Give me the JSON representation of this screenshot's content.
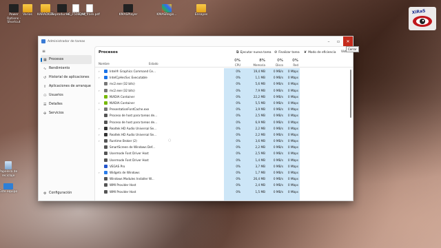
{
  "desktop_icons": [
    {
      "label": "Power\nOptions -\nShortcut",
      "kind": "app-dark"
    },
    {
      "label": "Varios",
      "kind": "folder"
    },
    {
      "label": "KARAOKES",
      "kind": "folder"
    },
    {
      "label": "Reproductor...",
      "kind": "app-dark"
    },
    {
      "label": "HC_F508.pdf",
      "kind": "doc"
    },
    {
      "label": "DNI_frare.pdf",
      "kind": "doc"
    },
    {
      "label": "KMASPlayer",
      "kind": "app-dark"
    },
    {
      "label": "KMASRegis...",
      "kind": "app-game"
    },
    {
      "label": "Ensayos",
      "kind": "folder"
    },
    {
      "label": "Papelera de reciclaje",
      "kind": "bin"
    },
    {
      "label": "Este equipo",
      "kind": "pc"
    }
  ],
  "window": {
    "title": "Administrador de tareas",
    "close_tooltip": "Cerrar"
  },
  "sidebar": {
    "items": [
      {
        "label": "Procesos",
        "icon": "grid-icon"
      },
      {
        "label": "Rendimiento",
        "icon": "chart-icon"
      },
      {
        "label": "Historial de aplicaciones",
        "icon": "history-icon"
      },
      {
        "label": "Aplicaciones de arranque",
        "icon": "rocket-icon"
      },
      {
        "label": "Usuarios",
        "icon": "users-icon"
      },
      {
        "label": "Detalles",
        "icon": "list-icon"
      },
      {
        "label": "Servicios",
        "icon": "puzzle-icon"
      }
    ],
    "settings": "Configuración"
  },
  "main": {
    "title": "Procesos",
    "toolbar": {
      "run": "Ejecutar nueva tarea",
      "end": "Finalizar tarea",
      "efficiency": "Modo de eficiencia",
      "view": "Vista"
    },
    "columns": {
      "name": "Nombre",
      "status": "Estado",
      "cpu_pct": "0%",
      "cpu": "CPU",
      "mem_pct": "8%",
      "mem": "Memoria",
      "disk_pct": "0%",
      "disk": "Disco",
      "net_pct": "0%",
      "net": "Red"
    },
    "rows": [
      {
        "name": "Intel® Graphics Command Ce...",
        "exp": true,
        "color": "#1a73e8",
        "cpu": "0%",
        "mem": "19,4 MB",
        "disk": "0 MB/s",
        "net": "0 Mbps"
      },
      {
        "name": "IntelCpHecSvc Executable",
        "exp": true,
        "color": "#1a73e8",
        "cpu": "0%",
        "mem": "1,1 MB",
        "disk": "0 MB/s",
        "net": "0 Mbps"
      },
      {
        "name": "mc2.exe (32 bits)",
        "exp": false,
        "color": "#777777",
        "cpu": "0%",
        "mem": "5,6 MB",
        "disk": "0 MB/s",
        "net": "0 Mbps"
      },
      {
        "name": "mc2.exe (32 bits)",
        "exp": true,
        "color": "#777777",
        "cpu": "0%",
        "mem": "7,9 MB",
        "disk": "0 MB/s",
        "net": "0 Mbps"
      },
      {
        "name": "NVIDIA Container",
        "exp": false,
        "color": "#76b900",
        "cpu": "0%",
        "mem": "22,2 MB",
        "disk": "0 MB/s",
        "net": "0 Mbps"
      },
      {
        "name": "NVIDIA Container",
        "exp": true,
        "color": "#76b900",
        "cpu": "0%",
        "mem": "5,5 MB",
        "disk": "0 MB/s",
        "net": "0 Mbps"
      },
      {
        "name": "PresentationFontCache.exe",
        "exp": true,
        "color": "#777777",
        "cpu": "0%",
        "mem": "3,9 MB",
        "disk": "0 MB/s",
        "net": "0 Mbps"
      },
      {
        "name": "Proceso de host para tareas de...",
        "exp": false,
        "color": "#555555",
        "cpu": "0%",
        "mem": "2,5 MB",
        "disk": "0 MB/s",
        "net": "0 Mbps"
      },
      {
        "name": "Proceso de host para tareas de...",
        "exp": false,
        "color": "#555555",
        "cpu": "0%",
        "mem": "6,9 MB",
        "disk": "0 MB/s",
        "net": "0 Mbps"
      },
      {
        "name": "Realtek HD Audio Universal Se...",
        "exp": true,
        "color": "#333333",
        "cpu": "0%",
        "mem": "2,2 MB",
        "disk": "0 MB/s",
        "net": "0 Mbps"
      },
      {
        "name": "Realtek HD Audio Universal Se...",
        "exp": true,
        "color": "#333333",
        "cpu": "0%",
        "mem": "2,2 MB",
        "disk": "0 MB/s",
        "net": "0 Mbps"
      },
      {
        "name": "Runtime Broker (2)",
        "exp": true,
        "color": "#555555",
        "cpu": "0%",
        "mem": "3,6 MB",
        "disk": "0 MB/s",
        "net": "0 Mbps",
        "leaf": true
      },
      {
        "name": "SmartScreen de Windows Def...",
        "exp": false,
        "color": "#555555",
        "cpu": "0%",
        "mem": "2,2 MB",
        "disk": "0 MB/s",
        "net": "0 Mbps"
      },
      {
        "name": "Usermode Font Driver Host",
        "exp": false,
        "color": "#555555",
        "cpu": "0%",
        "mem": "2,5 MB",
        "disk": "0 MB/s",
        "net": "0 Mbps"
      },
      {
        "name": "Usermode Font Driver Host",
        "exp": false,
        "color": "#555555",
        "cpu": "0%",
        "mem": "1,4 MB",
        "disk": "0 MB/s",
        "net": "0 Mbps"
      },
      {
        "name": "VEGAS Pro",
        "exp": false,
        "color": "#2255cc",
        "cpu": "0%",
        "mem": "3,7 MB",
        "disk": "0 MB/s",
        "net": "0 Mbps"
      },
      {
        "name": "Widgets de Windows",
        "exp": true,
        "color": "#2b7de9",
        "cpu": "0%",
        "mem": "1,7 MB",
        "disk": "0 MB/s",
        "net": "0 Mbps"
      },
      {
        "name": "Windows Modules Installer W...",
        "exp": false,
        "color": "#555555",
        "cpu": "0%",
        "mem": "26,4 MB",
        "disk": "0 MB/s",
        "net": "0 Mbps"
      },
      {
        "name": "WMI Provider Host",
        "exp": false,
        "color": "#555555",
        "cpu": "0%",
        "mem": "2,4 MB",
        "disk": "0 MB/s",
        "net": "0 Mbps"
      },
      {
        "name": "WMI Provider Host",
        "exp": false,
        "color": "#555555",
        "cpu": "0%",
        "mem": "1,5 MB",
        "disk": "0 MB/s",
        "net": "0 Mbps"
      }
    ]
  },
  "colors": {
    "accent": "#0067c0",
    "close": "#c42b1c",
    "highlight": "#cde6f7"
  }
}
